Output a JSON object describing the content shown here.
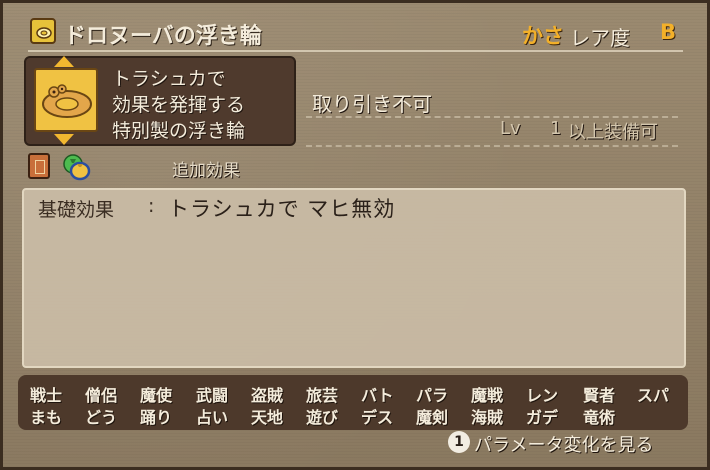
{
  "header": {
    "item_name": "ドロヌーバの浮き輪",
    "category": "かさ",
    "rarity_label": "レア度",
    "rarity_value": "B"
  },
  "description": {
    "lines": [
      "トラシュカで",
      "効果を発揮する",
      "特別製の浮き輪"
    ]
  },
  "trade_status": "取り引き不可",
  "level": {
    "prefix": "Lv",
    "value": "1",
    "suffix": "以上装備可"
  },
  "extra_effect_label": "追加効果",
  "effect": {
    "label": "基礎効果",
    "colon": ":",
    "text": "トラシュカで マヒ無効"
  },
  "jobs": {
    "row1": [
      "戦士",
      "僧侶",
      "魔使",
      "武闘",
      "盗賊",
      "旅芸",
      "バト",
      "パラ",
      "魔戦",
      "レン",
      "賢者",
      "スパ"
    ],
    "row2": [
      "まも",
      "どう",
      "踊り",
      "占い",
      "天地",
      "遊び",
      "デス",
      "魔剣",
      "海賊",
      "ガデ",
      "竜術"
    ]
  },
  "hint": {
    "button": "1",
    "text": "パラメータ変化を見る"
  },
  "colors": {
    "accent": "#f3b029",
    "text": "#f4ecdb",
    "panel": "#4f3a2d"
  },
  "icons": [
    "float-ring-icon",
    "book-icon",
    "bag-icon",
    "item-float-ring-icon"
  ]
}
